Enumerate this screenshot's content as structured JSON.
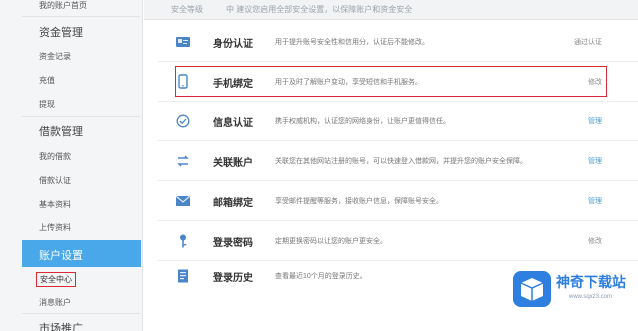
{
  "sidebar": {
    "top_link": "我的账户首页",
    "sections": [
      {
        "heading": "资金管理",
        "items": [
          "资金记录",
          "充值",
          "提现"
        ]
      },
      {
        "heading": "借款管理",
        "items": [
          "我的借款",
          "借款认证",
          "基本资料",
          "上传资料"
        ]
      }
    ],
    "active_section": "账户设置",
    "current_item": "安全中心",
    "next_item": "消息账户",
    "bottom_heading": "市场推广"
  },
  "notice": {
    "label": "安全等级",
    "text": "中  建议您启用全部安全设置，以保障账户和资金安全"
  },
  "rows": [
    {
      "title": "身份认证",
      "desc": "用于提升账号安全性和信用分，认证后不能修改。",
      "action": "通过认证",
      "action_color": "gray",
      "icon": "id-card-icon"
    },
    {
      "title": "手机绑定",
      "desc": "用于及时了解账户变动，享受短信和手机服务。",
      "action": "修改",
      "action_color": "gray",
      "icon": "mobile-phone-icon"
    },
    {
      "title": "信息认证",
      "desc": "携手权威机构，认证您的网络身份，让账户更值得信任。",
      "action": "管理",
      "action_color": "blue",
      "icon": "check-circle-icon"
    },
    {
      "title": "关联账户",
      "desc": "关联您在其他网站注册的账号，可以快速登入借款网，并提升您的账户安全保障。",
      "action": "管理",
      "action_color": "blue",
      "icon": "link-arrows-icon"
    },
    {
      "title": "邮箱绑定",
      "desc": "享受邮件提醒等服务，接收账户信息，保障账号安全。",
      "action": "管理",
      "action_color": "blue",
      "icon": "envelope-icon"
    },
    {
      "title": "登录密码",
      "desc": "定期更换密码以让您的账户更安全。",
      "action": "修改",
      "action_color": "gray",
      "icon": "key-icon"
    },
    {
      "title": "登录历史",
      "desc": "查看最近10个月的登录历史。",
      "action": "",
      "action_color": "gray",
      "icon": "document-list-icon"
    }
  ],
  "watermark": {
    "name": "神奇下载站",
    "url": "www.sqxz3.com"
  },
  "colors": {
    "accent": "#48a8ea",
    "highlight": "#d92b35",
    "link": "#4a9ad6"
  }
}
